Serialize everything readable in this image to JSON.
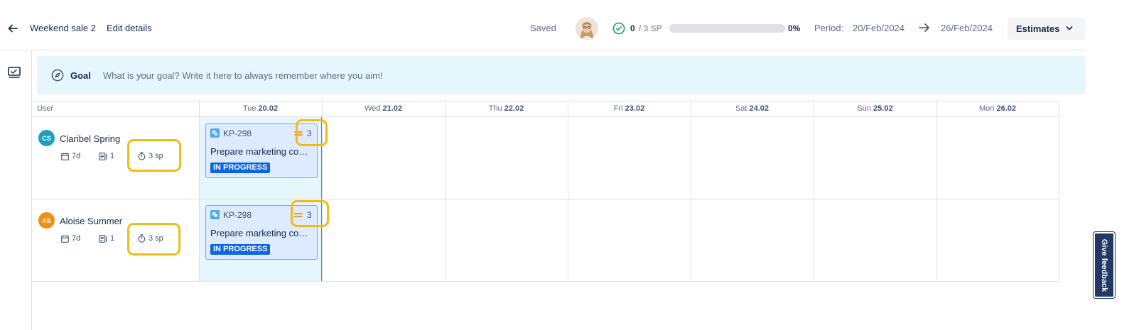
{
  "header": {
    "sprint_name": "Weekend sale 2",
    "edit_label": "Edit details",
    "saved_label": "Saved",
    "sp_done": "0",
    "sp_total": "/ 3 SP",
    "progress_fraction": 0.0,
    "progress_pct": "0%",
    "period_label": "Period:",
    "period_start": "20/Feb/2024",
    "period_end": "26/Feb/2024",
    "estimates_label": "Estimates"
  },
  "goal": {
    "label": "Goal",
    "placeholder": "What is your goal? Write it here to always remember where you aim!"
  },
  "grid": {
    "user_header": "User",
    "days": [
      {
        "dow": "Tue",
        "date": "20.02"
      },
      {
        "dow": "Wed",
        "date": "21.02"
      },
      {
        "dow": "Thu",
        "date": "22.02"
      },
      {
        "dow": "Fri",
        "date": "23.02"
      },
      {
        "dow": "Sat",
        "date": "24.02"
      },
      {
        "dow": "Sun",
        "date": "25.02"
      },
      {
        "dow": "Mon",
        "date": "26.02"
      }
    ],
    "users": [
      {
        "initials": "CS",
        "name": "Claribel Spring",
        "avatar_color": "#1e9fbf",
        "days": "7d",
        "issues": "1",
        "sp": "3 sp",
        "card": {
          "key": "KP-298",
          "estimate": "3",
          "title": "Prepare marketing content",
          "status": "IN PROGRESS"
        }
      },
      {
        "initials": "AS",
        "name": "Aloise Summer",
        "avatar_color": "#f18d13",
        "days": "7d",
        "issues": "1",
        "sp": "3 sp",
        "card": {
          "key": "KP-298",
          "estimate": "3",
          "title": "Prepare marketing content",
          "status": "IN PROGRESS"
        }
      }
    ]
  },
  "feedback_label": "Give feedback",
  "colors": {
    "accent": "#1f6fe5",
    "status": "#0c66e4",
    "annotation": "#f2bb1a",
    "priority": "#f18d13",
    "done_check": "#22a06b"
  }
}
